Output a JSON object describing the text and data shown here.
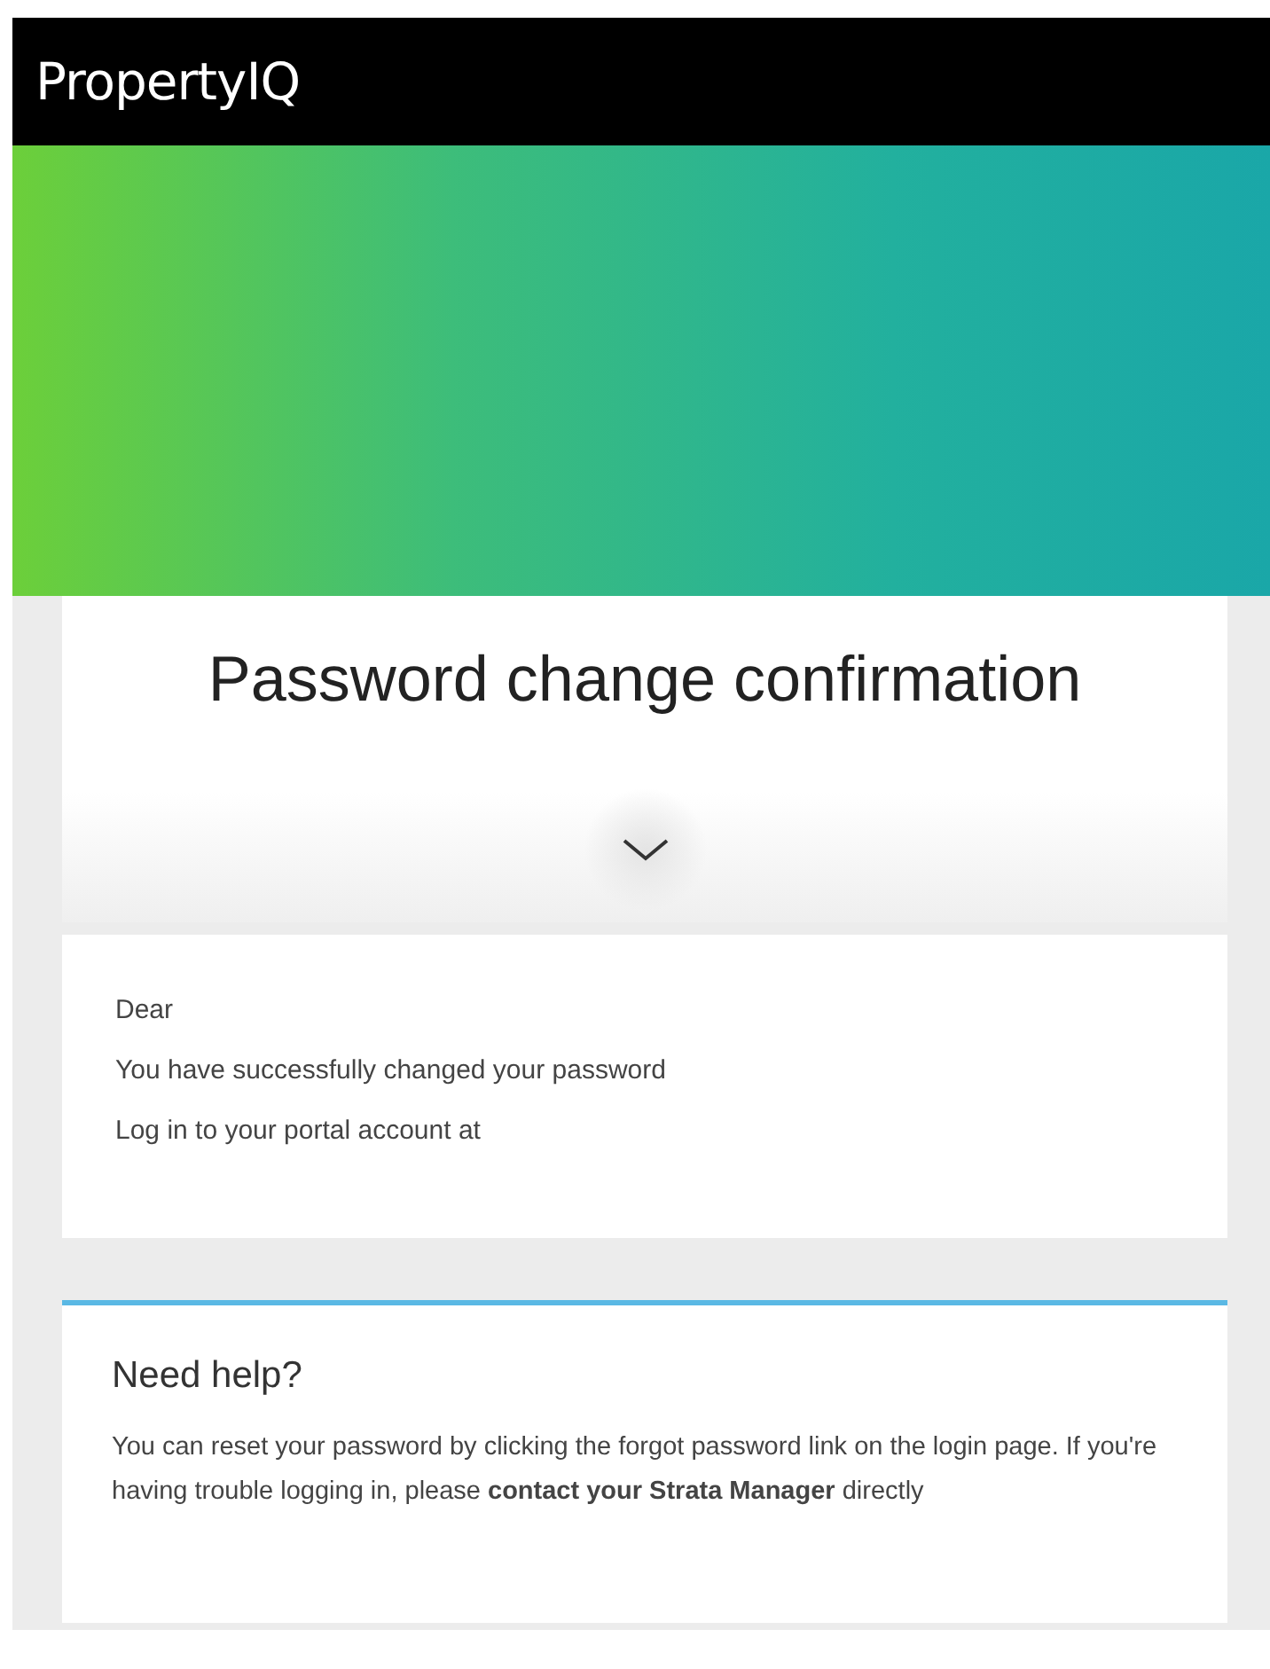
{
  "header": {
    "logo": "PropertyIQ"
  },
  "confirmation": {
    "title": "Password change confirmation"
  },
  "message": {
    "lines": [
      "Dear",
      "You have successfully changed your password",
      "Log in to your portal account at"
    ]
  },
  "help": {
    "title": "Need help?",
    "text": "You can reset your password by clicking the forgot password link on the login page. If you're having trouble logging in, please **contact your Strata Manager** directly"
  }
}
